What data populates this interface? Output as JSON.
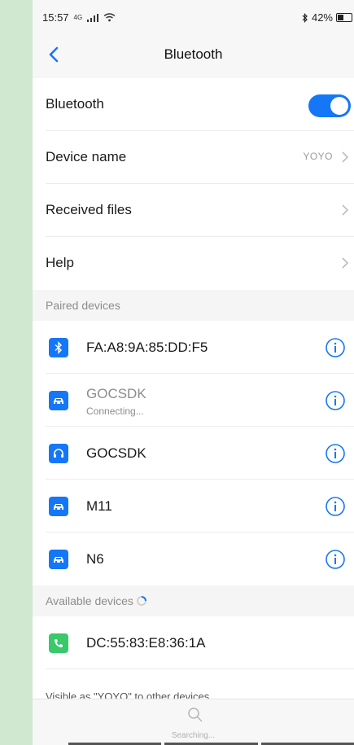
{
  "status_bar": {
    "time": "15:57",
    "signal": "4G",
    "battery": "42%"
  },
  "nav": {
    "title": "Bluetooth"
  },
  "settings": {
    "bluetooth_label": "Bluetooth",
    "bluetooth_on": true,
    "device_name_label": "Device name",
    "device_name_value": "YOYO",
    "received_files_label": "Received files",
    "help_label": "Help"
  },
  "paired": {
    "header": "Paired devices",
    "devices": [
      {
        "name": "FA:A8:9A:85:DD:F5",
        "icon": "bluetooth-icon",
        "status": ""
      },
      {
        "name": "GOCSDK",
        "icon": "car-icon",
        "status": "Connecting..."
      },
      {
        "name": "GOCSDK",
        "icon": "headset-icon",
        "status": ""
      },
      {
        "name": "M11",
        "icon": "car-icon",
        "status": ""
      },
      {
        "name": "N6",
        "icon": "car-icon",
        "status": ""
      }
    ]
  },
  "available": {
    "header": "Available devices",
    "devices": [
      {
        "name": "DC:55:83:E8:36:1A",
        "icon": "phone-icon"
      }
    ]
  },
  "footer": {
    "visible_text": "Visible as \"YOYO\" to other devices",
    "searching": "Searching..."
  },
  "colors": {
    "accent": "#1477f8",
    "phone_green": "#39c86a"
  }
}
